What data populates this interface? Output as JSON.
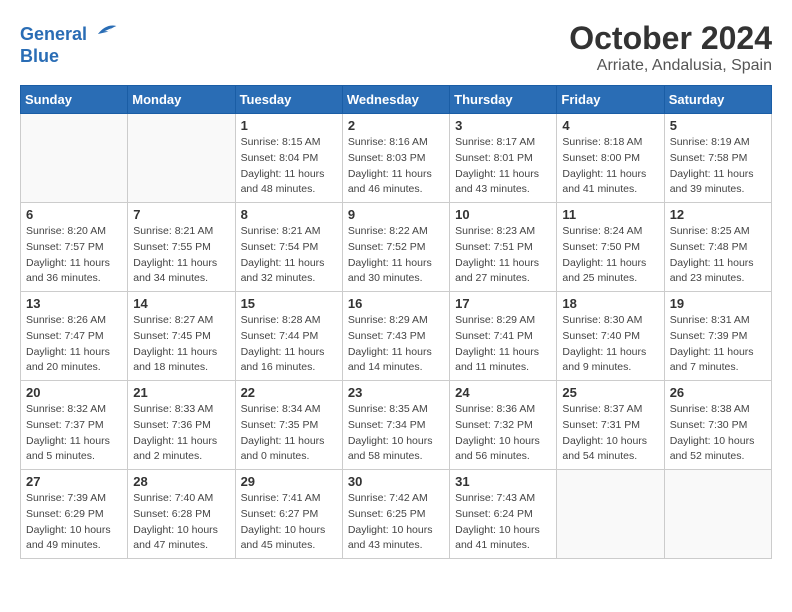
{
  "header": {
    "logo_line1": "General",
    "logo_line2": "Blue",
    "month_title": "October 2024",
    "location": "Arriate, Andalusia, Spain"
  },
  "weekdays": [
    "Sunday",
    "Monday",
    "Tuesday",
    "Wednesday",
    "Thursday",
    "Friday",
    "Saturday"
  ],
  "weeks": [
    [
      {
        "day": "",
        "detail": ""
      },
      {
        "day": "",
        "detail": ""
      },
      {
        "day": "1",
        "detail": "Sunrise: 8:15 AM\nSunset: 8:04 PM\nDaylight: 11 hours and 48 minutes."
      },
      {
        "day": "2",
        "detail": "Sunrise: 8:16 AM\nSunset: 8:03 PM\nDaylight: 11 hours and 46 minutes."
      },
      {
        "day": "3",
        "detail": "Sunrise: 8:17 AM\nSunset: 8:01 PM\nDaylight: 11 hours and 43 minutes."
      },
      {
        "day": "4",
        "detail": "Sunrise: 8:18 AM\nSunset: 8:00 PM\nDaylight: 11 hours and 41 minutes."
      },
      {
        "day": "5",
        "detail": "Sunrise: 8:19 AM\nSunset: 7:58 PM\nDaylight: 11 hours and 39 minutes."
      }
    ],
    [
      {
        "day": "6",
        "detail": "Sunrise: 8:20 AM\nSunset: 7:57 PM\nDaylight: 11 hours and 36 minutes."
      },
      {
        "day": "7",
        "detail": "Sunrise: 8:21 AM\nSunset: 7:55 PM\nDaylight: 11 hours and 34 minutes."
      },
      {
        "day": "8",
        "detail": "Sunrise: 8:21 AM\nSunset: 7:54 PM\nDaylight: 11 hours and 32 minutes."
      },
      {
        "day": "9",
        "detail": "Sunrise: 8:22 AM\nSunset: 7:52 PM\nDaylight: 11 hours and 30 minutes."
      },
      {
        "day": "10",
        "detail": "Sunrise: 8:23 AM\nSunset: 7:51 PM\nDaylight: 11 hours and 27 minutes."
      },
      {
        "day": "11",
        "detail": "Sunrise: 8:24 AM\nSunset: 7:50 PM\nDaylight: 11 hours and 25 minutes."
      },
      {
        "day": "12",
        "detail": "Sunrise: 8:25 AM\nSunset: 7:48 PM\nDaylight: 11 hours and 23 minutes."
      }
    ],
    [
      {
        "day": "13",
        "detail": "Sunrise: 8:26 AM\nSunset: 7:47 PM\nDaylight: 11 hours and 20 minutes."
      },
      {
        "day": "14",
        "detail": "Sunrise: 8:27 AM\nSunset: 7:45 PM\nDaylight: 11 hours and 18 minutes."
      },
      {
        "day": "15",
        "detail": "Sunrise: 8:28 AM\nSunset: 7:44 PM\nDaylight: 11 hours and 16 minutes."
      },
      {
        "day": "16",
        "detail": "Sunrise: 8:29 AM\nSunset: 7:43 PM\nDaylight: 11 hours and 14 minutes."
      },
      {
        "day": "17",
        "detail": "Sunrise: 8:29 AM\nSunset: 7:41 PM\nDaylight: 11 hours and 11 minutes."
      },
      {
        "day": "18",
        "detail": "Sunrise: 8:30 AM\nSunset: 7:40 PM\nDaylight: 11 hours and 9 minutes."
      },
      {
        "day": "19",
        "detail": "Sunrise: 8:31 AM\nSunset: 7:39 PM\nDaylight: 11 hours and 7 minutes."
      }
    ],
    [
      {
        "day": "20",
        "detail": "Sunrise: 8:32 AM\nSunset: 7:37 PM\nDaylight: 11 hours and 5 minutes."
      },
      {
        "day": "21",
        "detail": "Sunrise: 8:33 AM\nSunset: 7:36 PM\nDaylight: 11 hours and 2 minutes."
      },
      {
        "day": "22",
        "detail": "Sunrise: 8:34 AM\nSunset: 7:35 PM\nDaylight: 11 hours and 0 minutes."
      },
      {
        "day": "23",
        "detail": "Sunrise: 8:35 AM\nSunset: 7:34 PM\nDaylight: 10 hours and 58 minutes."
      },
      {
        "day": "24",
        "detail": "Sunrise: 8:36 AM\nSunset: 7:32 PM\nDaylight: 10 hours and 56 minutes."
      },
      {
        "day": "25",
        "detail": "Sunrise: 8:37 AM\nSunset: 7:31 PM\nDaylight: 10 hours and 54 minutes."
      },
      {
        "day": "26",
        "detail": "Sunrise: 8:38 AM\nSunset: 7:30 PM\nDaylight: 10 hours and 52 minutes."
      }
    ],
    [
      {
        "day": "27",
        "detail": "Sunrise: 7:39 AM\nSunset: 6:29 PM\nDaylight: 10 hours and 49 minutes."
      },
      {
        "day": "28",
        "detail": "Sunrise: 7:40 AM\nSunset: 6:28 PM\nDaylight: 10 hours and 47 minutes."
      },
      {
        "day": "29",
        "detail": "Sunrise: 7:41 AM\nSunset: 6:27 PM\nDaylight: 10 hours and 45 minutes."
      },
      {
        "day": "30",
        "detail": "Sunrise: 7:42 AM\nSunset: 6:25 PM\nDaylight: 10 hours and 43 minutes."
      },
      {
        "day": "31",
        "detail": "Sunrise: 7:43 AM\nSunset: 6:24 PM\nDaylight: 10 hours and 41 minutes."
      },
      {
        "day": "",
        "detail": ""
      },
      {
        "day": "",
        "detail": ""
      }
    ]
  ]
}
